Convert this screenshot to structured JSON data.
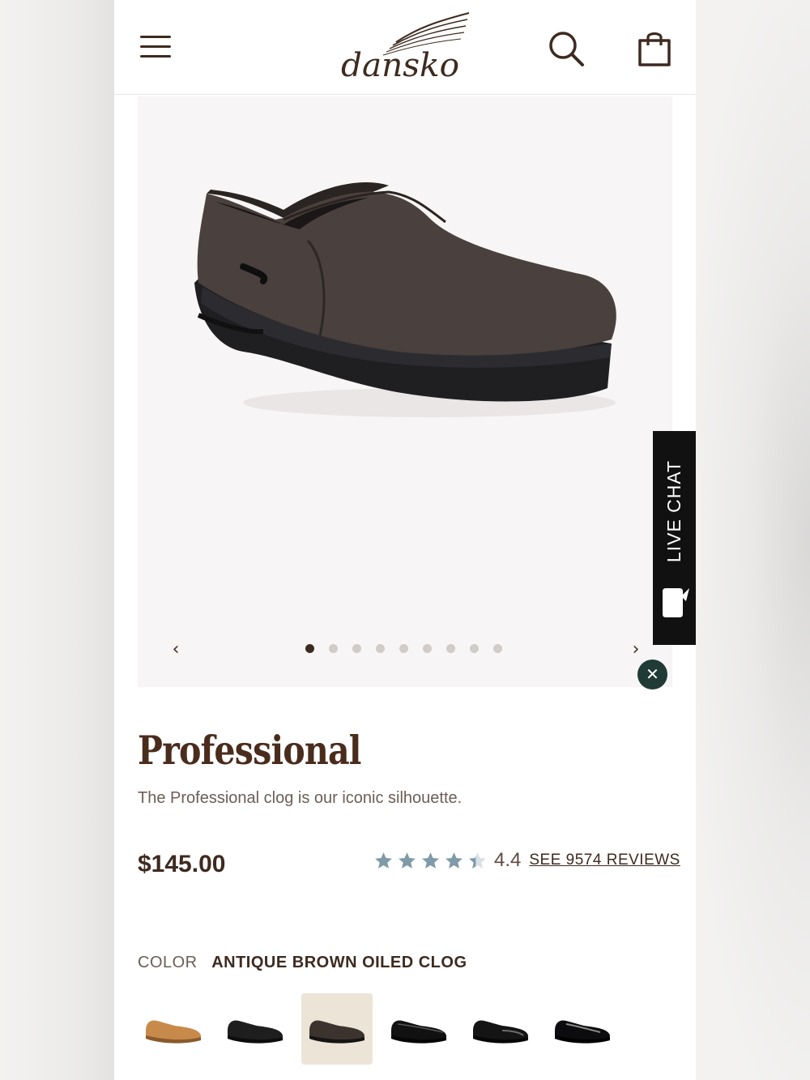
{
  "colors": {
    "brand_brown": "#3e2a20",
    "chat_dark": "#111111",
    "close_green": "#203a35",
    "star_blue": "#7f9aa9"
  },
  "header": {
    "logo_text": "dansko",
    "menu_icon": "hamburger-menu-icon",
    "search_icon": "search-icon",
    "bag_icon": "shopping-bag-icon"
  },
  "gallery": {
    "prev_label": "‹",
    "next_label": "›",
    "slides_count": 9,
    "active_slide": 1
  },
  "live_chat": {
    "label": "LIVE CHAT",
    "close_label": "✕"
  },
  "product": {
    "name": "Professional",
    "description": "The Professional clog is our iconic silhouette.",
    "price": "$145.00",
    "rating_value": "4.4",
    "rating_stars": 4.4,
    "reviews_link": "SEE 9574 REVIEWS",
    "color_label": "COLOR",
    "color_value": "ANTIQUE BROWN OILED CLOG"
  },
  "swatches": [
    {
      "color": "#c88a4a",
      "selected": false
    },
    {
      "color": "#1e1e1f",
      "selected": false
    },
    {
      "color": "#3d332e",
      "selected": true
    },
    {
      "color": "#111112",
      "selected": false
    },
    {
      "color": "#141414",
      "selected": false
    },
    {
      "color": "#0c0c0e",
      "selected": false
    }
  ]
}
